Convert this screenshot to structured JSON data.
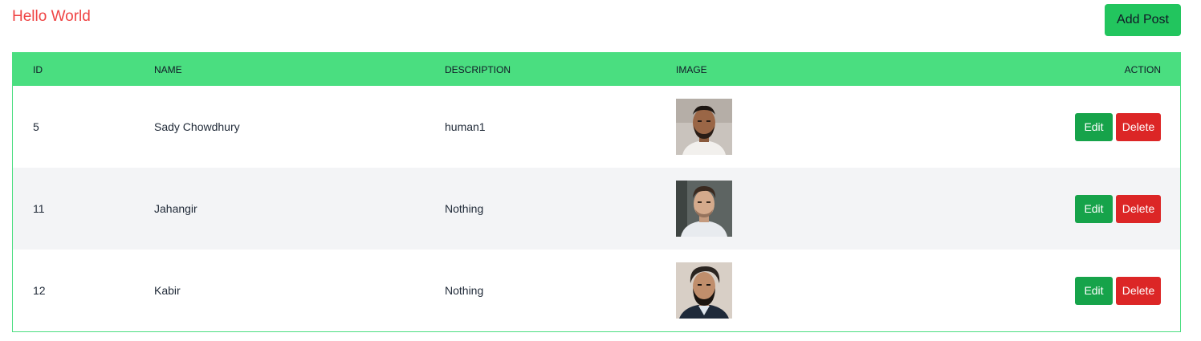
{
  "header": {
    "title": "Hello World",
    "add_post_label": "Add Post"
  },
  "table": {
    "columns": [
      "ID",
      "NAME",
      "DESCRIPTION",
      "IMAGE",
      "ACTION"
    ],
    "rows": [
      {
        "id": "5",
        "name": "Sady Chowdhury",
        "description": "human1",
        "edit_label": "Edit",
        "delete_label": "Delete"
      },
      {
        "id": "11",
        "name": "Jahangir",
        "description": "Nothing",
        "edit_label": "Edit",
        "delete_label": "Delete"
      },
      {
        "id": "12",
        "name": "Kabir",
        "description": "Nothing",
        "edit_label": "Edit",
        "delete_label": "Delete"
      }
    ]
  },
  "colors": {
    "title": "#ef4444",
    "header_bg": "#4ade80",
    "add_button": "#22c55e",
    "edit_button": "#16a34a",
    "delete_button": "#dc2626",
    "alt_row": "#f3f4f6"
  }
}
